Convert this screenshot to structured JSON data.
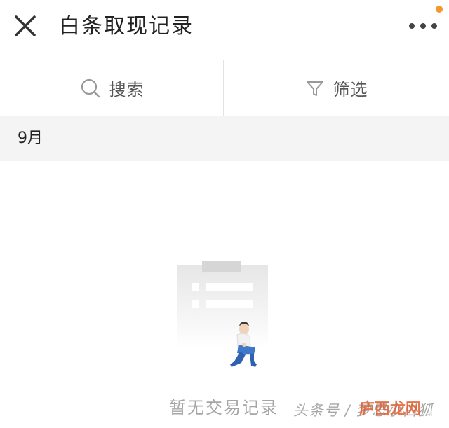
{
  "header": {
    "title": "白条取现记录",
    "close_icon": "close-icon",
    "more_icon": "more-dots-icon",
    "notify_color": "#f39a2b"
  },
  "toolbar": {
    "search_label": "搜索",
    "filter_label": "筛选"
  },
  "list": {
    "month": "9月"
  },
  "empty_state": {
    "illustration": "empty-clipboard-person-icon",
    "text": "暂无交易记录"
  },
  "watermark": {
    "text": "头条号 / 梦思小白狐",
    "logo_text": "庐西龙网"
  }
}
